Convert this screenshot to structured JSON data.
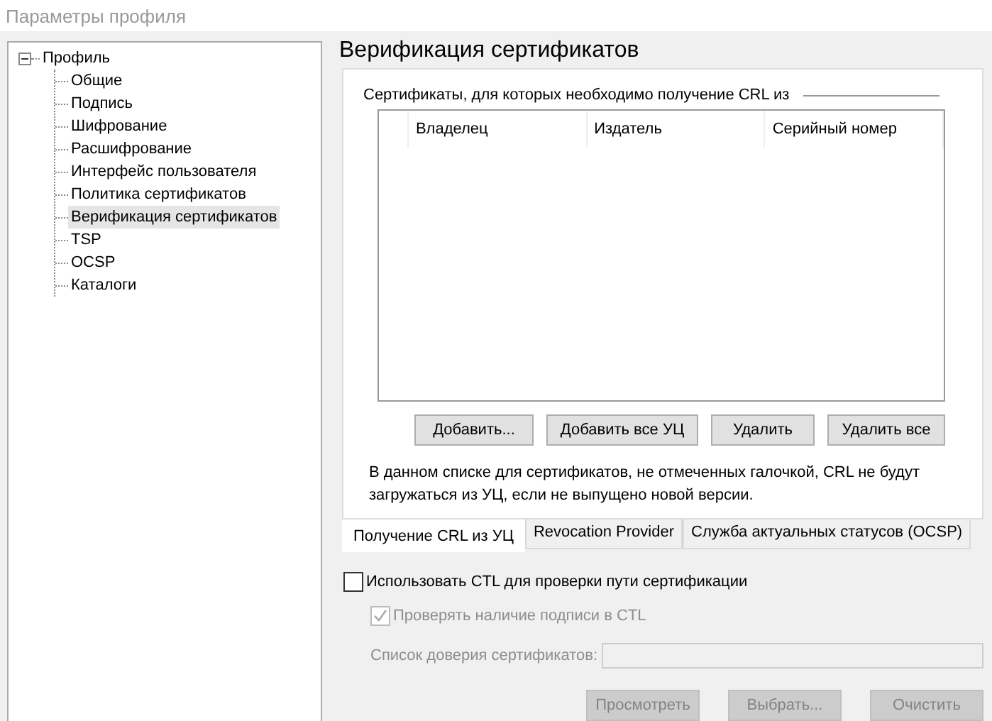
{
  "window": {
    "title": "Параметры профиля"
  },
  "tree": {
    "label": "Профиль",
    "expanded": true,
    "children": [
      {
        "label": "Общие",
        "selected": false
      },
      {
        "label": "Подпись",
        "selected": false
      },
      {
        "label": "Шифрование",
        "selected": false
      },
      {
        "label": "Расшифрование",
        "selected": false
      },
      {
        "label": "Интерфейс пользователя",
        "selected": false
      },
      {
        "label": "Политика сертификатов",
        "selected": false
      },
      {
        "label": "Верификация сертификатов",
        "selected": true
      },
      {
        "label": "TSP",
        "selected": false
      },
      {
        "label": "OCSP",
        "selected": false
      },
      {
        "label": "Каталоги",
        "selected": false
      }
    ]
  },
  "heading": "Верификация сертификатов",
  "crl_group": {
    "label": "Сертификаты, для которых необходимо получение CRL из",
    "table": {
      "columns": [
        "Владелец",
        "Издатель",
        "Серийный номер"
      ]
    },
    "buttons": [
      "Добавить...",
      "Добавить все УЦ",
      "Удалить",
      "Удалить все"
    ],
    "note": "В данном списке для сертификатов, не отмеченных галочкой, CRL не будут загружаться из УЦ, если не выпущено новой версии."
  },
  "tabs": [
    {
      "label": "Получение CRL из УЦ",
      "selected": true
    },
    {
      "label": "Revocation Provider",
      "selected": false
    },
    {
      "label": "Служба актуальных статусов (OCSP)",
      "selected": false
    }
  ],
  "checkboxes": [
    {
      "label": "Использовать CTL для проверки пути сертификации",
      "checked": false,
      "disabled": false
    },
    {
      "label": "Проверять наличие подписи в CTL",
      "checked": true,
      "disabled": true
    }
  ],
  "trust_list": {
    "label": "Список доверия сертификатов:",
    "disabled": true
  },
  "bottom_buttons": [
    {
      "label": "Просмотреть",
      "disabled": true
    },
    {
      "label": "Выбрать...",
      "disabled": true
    },
    {
      "label": "Очистить",
      "disabled": true
    }
  ]
}
